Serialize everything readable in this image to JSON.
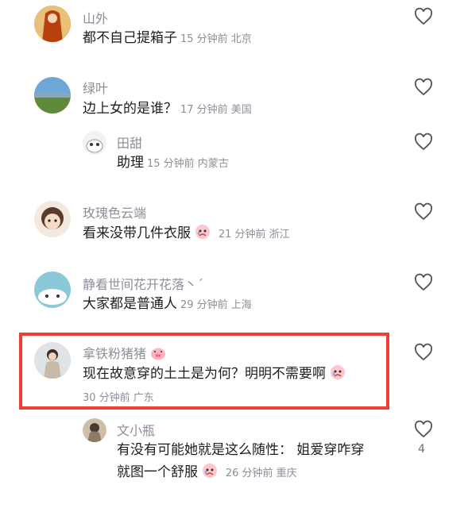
{
  "comments": [
    {
      "user": "山外",
      "text": "都不自己提箱子",
      "meta": "15 分钟前 北京"
    },
    {
      "user": "绿叶",
      "text": "边上女的是谁？",
      "meta": "17 分钟前 美国"
    },
    {
      "user": "田甜",
      "text": "助理",
      "meta": "15 分钟前 内蒙古"
    },
    {
      "user": "玫瑰色云端",
      "text": "看来没带几件衣服",
      "meta": "21 分钟前 浙江"
    },
    {
      "user": "静看世间花开花落丶ˊ",
      "text": "大家都是普通人",
      "meta": "29 分钟前 上海"
    },
    {
      "user": "拿铁粉猪猪",
      "text": "现在故意穿的土土是为何？明明不需要啊",
      "meta": "30 分钟前 广东"
    },
    {
      "user": "文小瓶",
      "text": "有没有可能她就是这么随性： 姐爱穿咋穿",
      "text2": "就图一个舒服",
      "meta": "26 分钟前 重庆",
      "likes": "4"
    }
  ],
  "icons": {
    "like": "heart-outline-icon",
    "emoji": "crying-face-emoji",
    "badge": "pig-face-icon"
  },
  "colors": {
    "highlight": "#ef3e36",
    "meta": "#8b8f99"
  }
}
